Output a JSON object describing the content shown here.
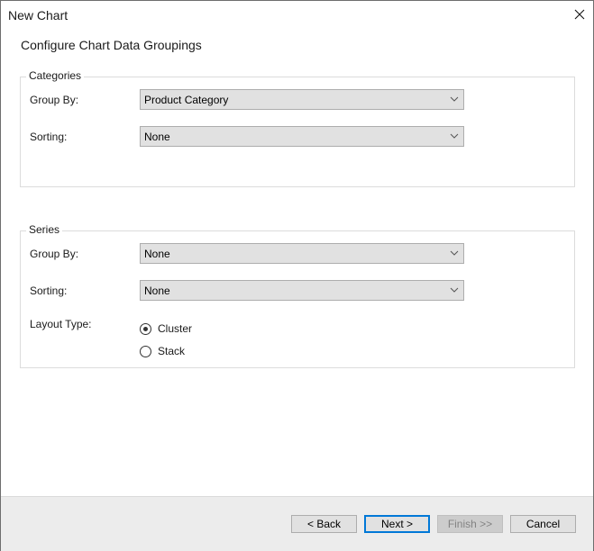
{
  "window": {
    "title": "New Chart",
    "close_icon": "close-icon"
  },
  "page": {
    "heading": "Configure Chart Data Groupings"
  },
  "categories": {
    "legend": "Categories",
    "group_by_label": "Group By:",
    "group_by_value": "Product Category",
    "sorting_label": "Sorting:",
    "sorting_value": "None"
  },
  "series": {
    "legend": "Series",
    "group_by_label": "Group By:",
    "group_by_value": "None",
    "sorting_label": "Sorting:",
    "sorting_value": "None",
    "layout_type_label": "Layout Type:",
    "layout_options": [
      {
        "label": "Cluster",
        "selected": true
      },
      {
        "label": "Stack",
        "selected": false
      }
    ]
  },
  "footer": {
    "back_label": "< Back",
    "next_label": "Next >",
    "finish_label": "Finish >>",
    "cancel_label": "Cancel"
  },
  "colors": {
    "focus_accent": "#0078d7",
    "control_bg": "#e1e1e1",
    "footer_bg": "#ececec"
  }
}
